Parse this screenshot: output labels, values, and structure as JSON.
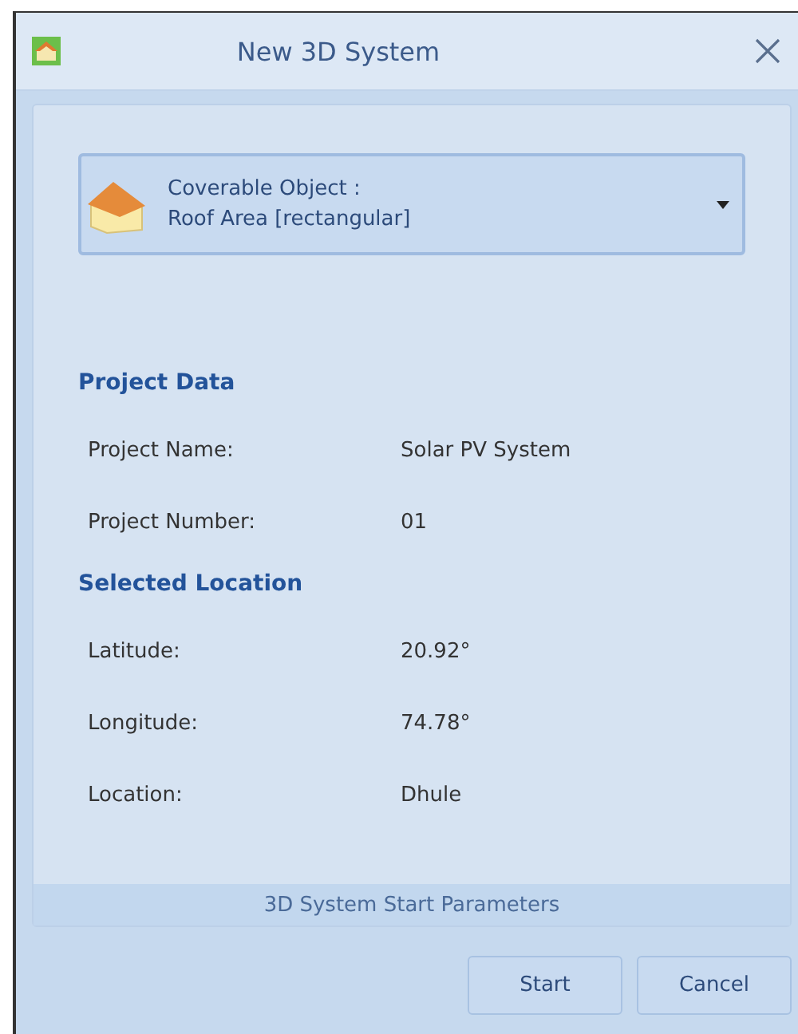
{
  "window": {
    "title": "New 3D System"
  },
  "dropdown": {
    "label": "Coverable Object :",
    "value": "Roof Area [rectangular]"
  },
  "sections": [
    {
      "heading": "Project Data",
      "rows": [
        {
          "label": "Project Name:",
          "value": "Solar PV System"
        },
        {
          "label": "Project Number:",
          "value": "01"
        }
      ]
    },
    {
      "heading": "Selected Location",
      "rows": [
        {
          "label": "Latitude:",
          "value": "20.92°"
        },
        {
          "label": "Longitude:",
          "value": "74.78°"
        },
        {
          "label": "Location:",
          "value": "Dhule"
        }
      ]
    }
  ],
  "panel_caption": "3D System Start Parameters",
  "buttons": [
    "Start",
    "Cancel"
  ]
}
